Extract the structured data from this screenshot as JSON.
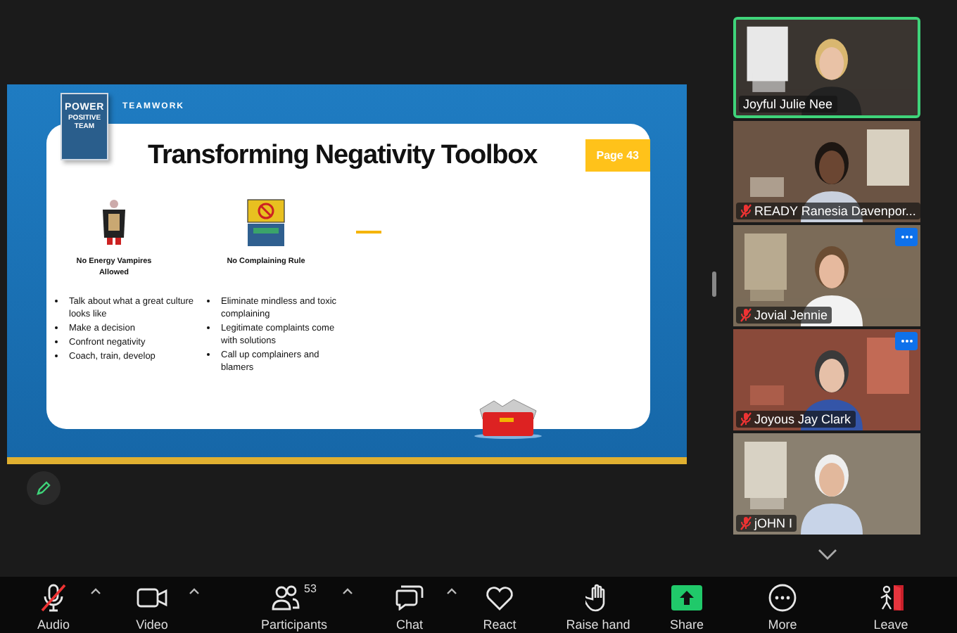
{
  "shared_slide": {
    "section": "TEAMWORK",
    "book_cover": {
      "title": "POWER",
      "subtitle": "POSITIVE TEAM"
    },
    "title": "Transforming Negativity Toolbox",
    "page_badge": "Page 43",
    "tools": [
      {
        "kind": "vampire",
        "caption": "No Energy Vampires Allowed",
        "bullets": [
          "Talk about what a great culture looks like",
          "Make a decision",
          "Confront negativity",
          "Coach, train, develop"
        ]
      },
      {
        "kind": "sign",
        "caption": "No Complaining Rule",
        "bullets": [
          "Eliminate mindless and toxic complaining",
          "Legitimate complaints come with solutions",
          "Call up complainers and blamers"
        ]
      }
    ]
  },
  "participants": [
    {
      "name": "Joyful Julie Nee",
      "muted": false,
      "speaking": true,
      "menu_button": false
    },
    {
      "name": "READY Ranesia Davenpor...",
      "muted": true,
      "speaking": false,
      "menu_button": false
    },
    {
      "name": "Jovial Jennie",
      "muted": true,
      "speaking": false,
      "menu_button": true
    },
    {
      "name": "Joyous Jay Clark",
      "muted": true,
      "speaking": false,
      "menu_button": true
    },
    {
      "name": "jOHN I",
      "muted": true,
      "speaking": false,
      "menu_button": false
    }
  ],
  "toolbar": [
    {
      "kind": "audio",
      "label": "Audio",
      "muted": true,
      "caret": true
    },
    {
      "kind": "video",
      "label": "Video",
      "caret": true
    },
    {
      "kind": "participants",
      "label": "Participants",
      "count": "53",
      "caret": true
    },
    {
      "kind": "chat",
      "label": "Chat",
      "caret": true
    },
    {
      "kind": "react",
      "label": "React",
      "caret": false
    },
    {
      "kind": "raise",
      "label": "Raise hand",
      "caret": false
    },
    {
      "kind": "share",
      "label": "Share",
      "caret": false
    },
    {
      "kind": "more",
      "label": "More",
      "caret": false
    },
    {
      "kind": "leave",
      "label": "Leave",
      "caret": false
    }
  ]
}
